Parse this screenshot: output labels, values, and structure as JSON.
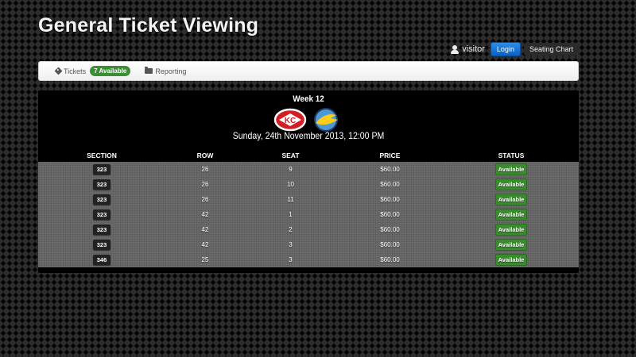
{
  "page": {
    "title": "General Ticket Viewing"
  },
  "userbar": {
    "username": "visitor",
    "login_label": "Login",
    "seating_chart_label": "Seating Chart"
  },
  "nav": {
    "tickets_label": "Tickets",
    "tickets_badge": "7 Available",
    "reporting_label": "Reporting"
  },
  "game": {
    "week": "Week 12",
    "date": "Sunday, 24th November 2013, 12:00 PM",
    "home_logo": "chiefs-logo",
    "away_logo": "chargers-logo"
  },
  "table": {
    "headers": [
      "SECTION",
      "ROW",
      "SEAT",
      "PRICE",
      "STATUS"
    ],
    "rows": [
      {
        "section": "323",
        "row": "26",
        "seat": "9",
        "price": "$60.00",
        "status": "Available"
      },
      {
        "section": "323",
        "row": "26",
        "seat": "10",
        "price": "$60.00",
        "status": "Available"
      },
      {
        "section": "323",
        "row": "26",
        "seat": "11",
        "price": "$60.00",
        "status": "Available"
      },
      {
        "section": "323",
        "row": "42",
        "seat": "1",
        "price": "$60.00",
        "status": "Available"
      },
      {
        "section": "323",
        "row": "42",
        "seat": "2",
        "price": "$60.00",
        "status": "Available"
      },
      {
        "section": "323",
        "row": "42",
        "seat": "3",
        "price": "$60.00",
        "status": "Available"
      },
      {
        "section": "346",
        "row": "25",
        "seat": "3",
        "price": "$60.00",
        "status": "Available"
      }
    ]
  },
  "colors": {
    "login_blue": "#0a62c7",
    "available_green": "#3a8b2e",
    "chiefs_red": "#d21f26",
    "chargers_blue": "#3b8ed1"
  }
}
